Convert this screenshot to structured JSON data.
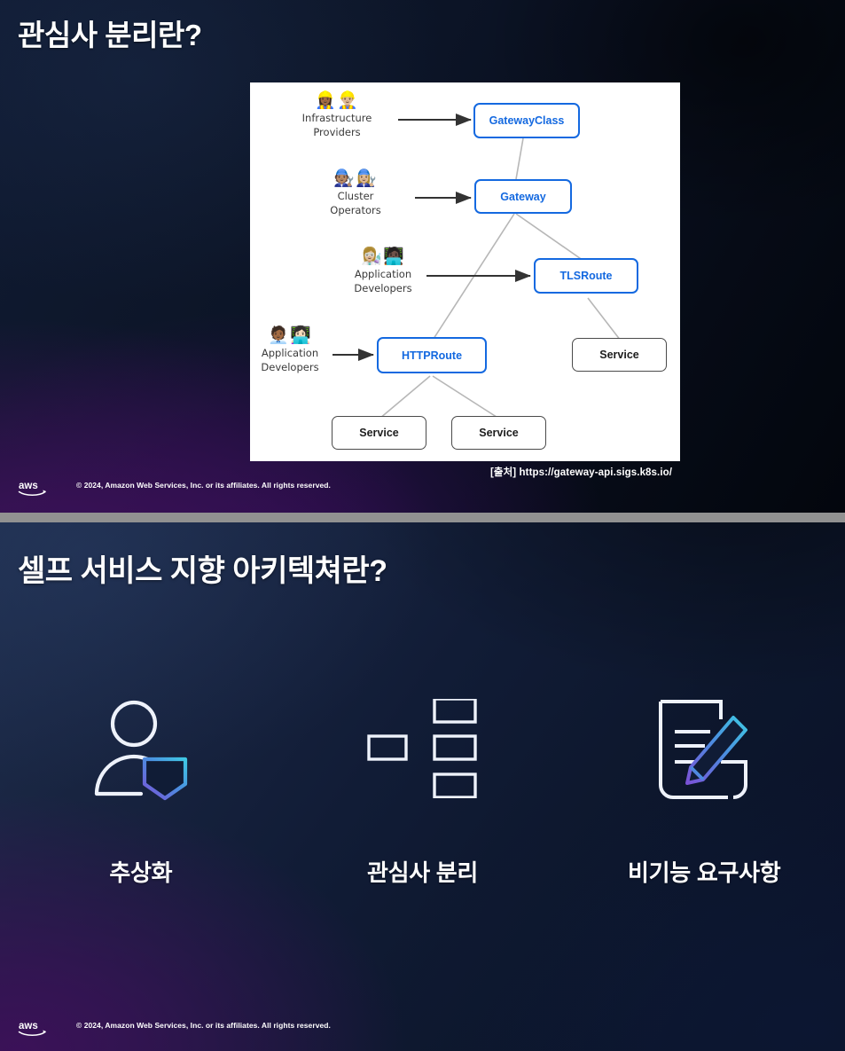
{
  "slide1": {
    "title": "관심사 분리란?",
    "source_note": "[출처] https://gateway-api.sigs.k8s.io/",
    "diagram": {
      "personas": [
        {
          "id": "infrastructure-providers",
          "emoji": "👷🏾‍♀️👷🏼‍♂️",
          "label_line1": "Infrastructure",
          "label_line2": "Providers"
        },
        {
          "id": "cluster-operators",
          "emoji": "🧑🏽‍🔧👩🏼‍🔧",
          "label_line1": "Cluster",
          "label_line2": "Operators"
        },
        {
          "id": "application-developers-tls",
          "emoji": "👩🏼‍🔬🧑🏿‍💻",
          "label_line1": "Application",
          "label_line2": "Developers"
        },
        {
          "id": "application-developers-http",
          "emoji": "🧑🏾‍💼👩🏻‍💻",
          "label_line1": "Application",
          "label_line2": "Developers"
        }
      ],
      "nodes": [
        {
          "id": "gatewayclass",
          "label": "GatewayClass",
          "style": "blue"
        },
        {
          "id": "gateway",
          "label": "Gateway",
          "style": "blue"
        },
        {
          "id": "tlsroute",
          "label": "TLSRoute",
          "style": "blue"
        },
        {
          "id": "httproute",
          "label": "HTTPRoute",
          "style": "blue"
        },
        {
          "id": "service-tls",
          "label": "Service",
          "style": "gray"
        },
        {
          "id": "service-http-1",
          "label": "Service",
          "style": "gray"
        },
        {
          "id": "service-http-2",
          "label": "Service",
          "style": "gray"
        }
      ]
    },
    "footer": {
      "copyright": "© 2024, Amazon Web Services, Inc. or its affiliates. All rights reserved.",
      "logo": "aws-logo"
    }
  },
  "slide2": {
    "title": "셀프 서비스 지향 아키텍쳐란?",
    "pillars": [
      {
        "id": "abstraction",
        "icon": "user-shield-icon",
        "label": "추상화"
      },
      {
        "id": "separation-of-concerns",
        "icon": "hierarchy-tree-icon",
        "label": "관심사 분리"
      },
      {
        "id": "non-functional-requirements",
        "icon": "document-pencil-icon",
        "label": "비기능 요구사항"
      }
    ],
    "footer": {
      "copyright": "© 2024, Amazon Web Services, Inc. or its affiliates. All rights reserved.",
      "logo": "aws-logo"
    }
  },
  "colors": {
    "node_blue": "#1469e0",
    "node_gray": "#4a4a4a",
    "separator_gray": "#919191",
    "accent_cyan": "#3fc8e4",
    "accent_purple": "#7a52d6",
    "title_white": "#ffffff"
  }
}
